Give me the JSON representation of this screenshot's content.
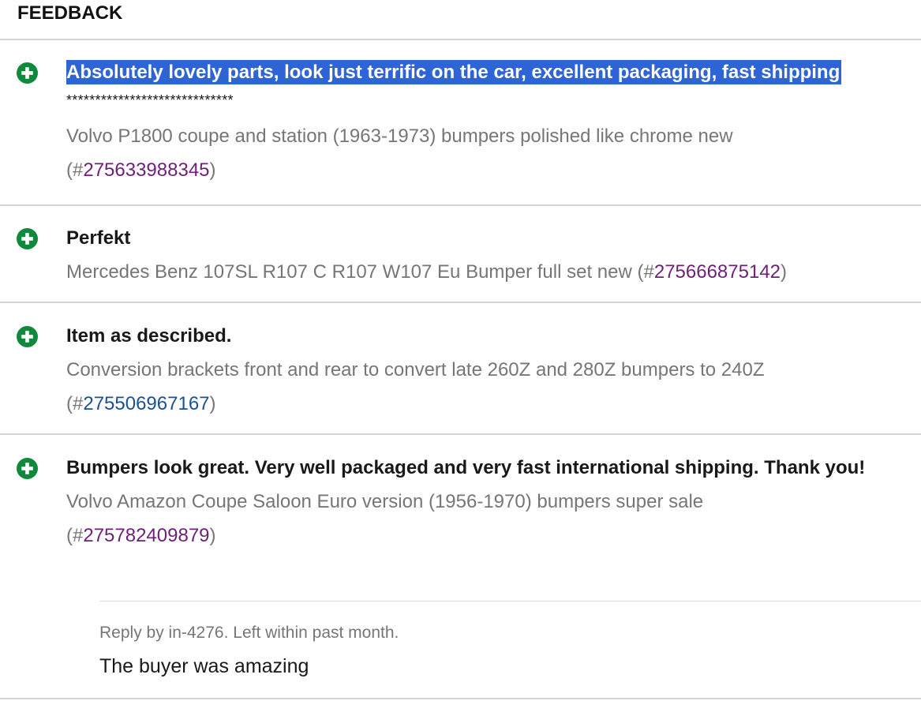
{
  "heading": "FEEDBACK",
  "colors": {
    "positive_icon": "#0f8a3c",
    "selection": "#2e64d6",
    "visited_link": "#6f1f7a",
    "link": "#1a5196",
    "muted_text": "#767676"
  },
  "entries": [
    {
      "icon": "positive-feedback-plus-icon",
      "comment": "Absolutely lovely parts, look just terrific on the car, excellent packaging, fast shipping",
      "stars": "*****************************",
      "item_text": "Volvo P1800 coupe and station (1963-1973) bumpers polished like chrome new",
      "item_open": "(#",
      "item_number": "275633988345",
      "item_close": ")"
    },
    {
      "icon": "positive-feedback-plus-icon",
      "comment": "Perfekt",
      "item_text": "Mercedes Benz 107SL R107 C R107 W107 Eu Bumper full set new",
      "item_open": "(#",
      "item_number": "275666875142",
      "item_close": ")"
    },
    {
      "icon": "positive-feedback-plus-icon",
      "comment": "Item as described.",
      "item_text": "Conversion brackets front and rear to convert late 260Z and 280Z bumpers to 240Z",
      "item_open": "(#",
      "item_number": "275506967167",
      "item_close": ")"
    },
    {
      "icon": "positive-feedback-plus-icon",
      "comment": "Bumpers look great. Very well packaged and very fast international shipping. Thank you!",
      "item_text": "Volvo Amazon Coupe Saloon Euro version (1956-1970) bumpers super sale",
      "item_open": "(#",
      "item_number": "275782409879",
      "item_close": ")",
      "reply": {
        "meta": "Reply by in-4276. Left within past month.",
        "text": "The buyer was amazing"
      }
    }
  ]
}
